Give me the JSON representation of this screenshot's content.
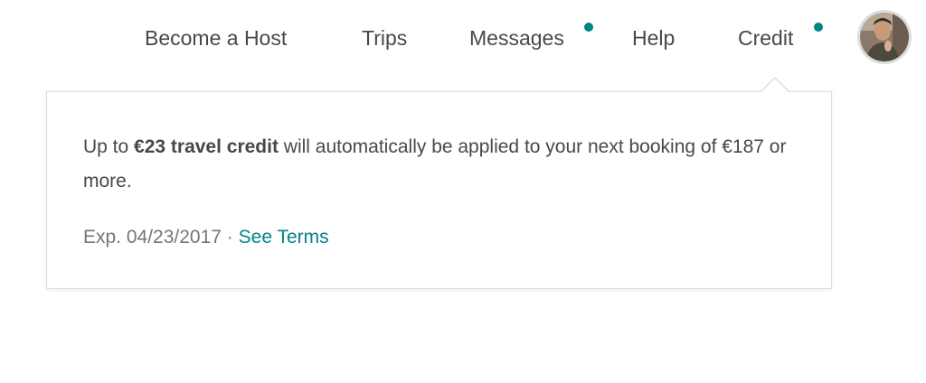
{
  "nav": {
    "become_host": "Become a Host",
    "trips": "Trips",
    "messages": "Messages",
    "help": "Help",
    "credit": "Credit",
    "notification_color": "#008489"
  },
  "avatar": {
    "icon": "user-avatar"
  },
  "credit_popover": {
    "message_prefix": "Up to ",
    "amount": "€23 travel credit",
    "message_suffix": " will automatically be applied to your next booking of €187 or more.",
    "expiry": "Exp. 04/23/2017",
    "separator": " · ",
    "terms_link": "See Terms",
    "link_color": "#008489"
  }
}
